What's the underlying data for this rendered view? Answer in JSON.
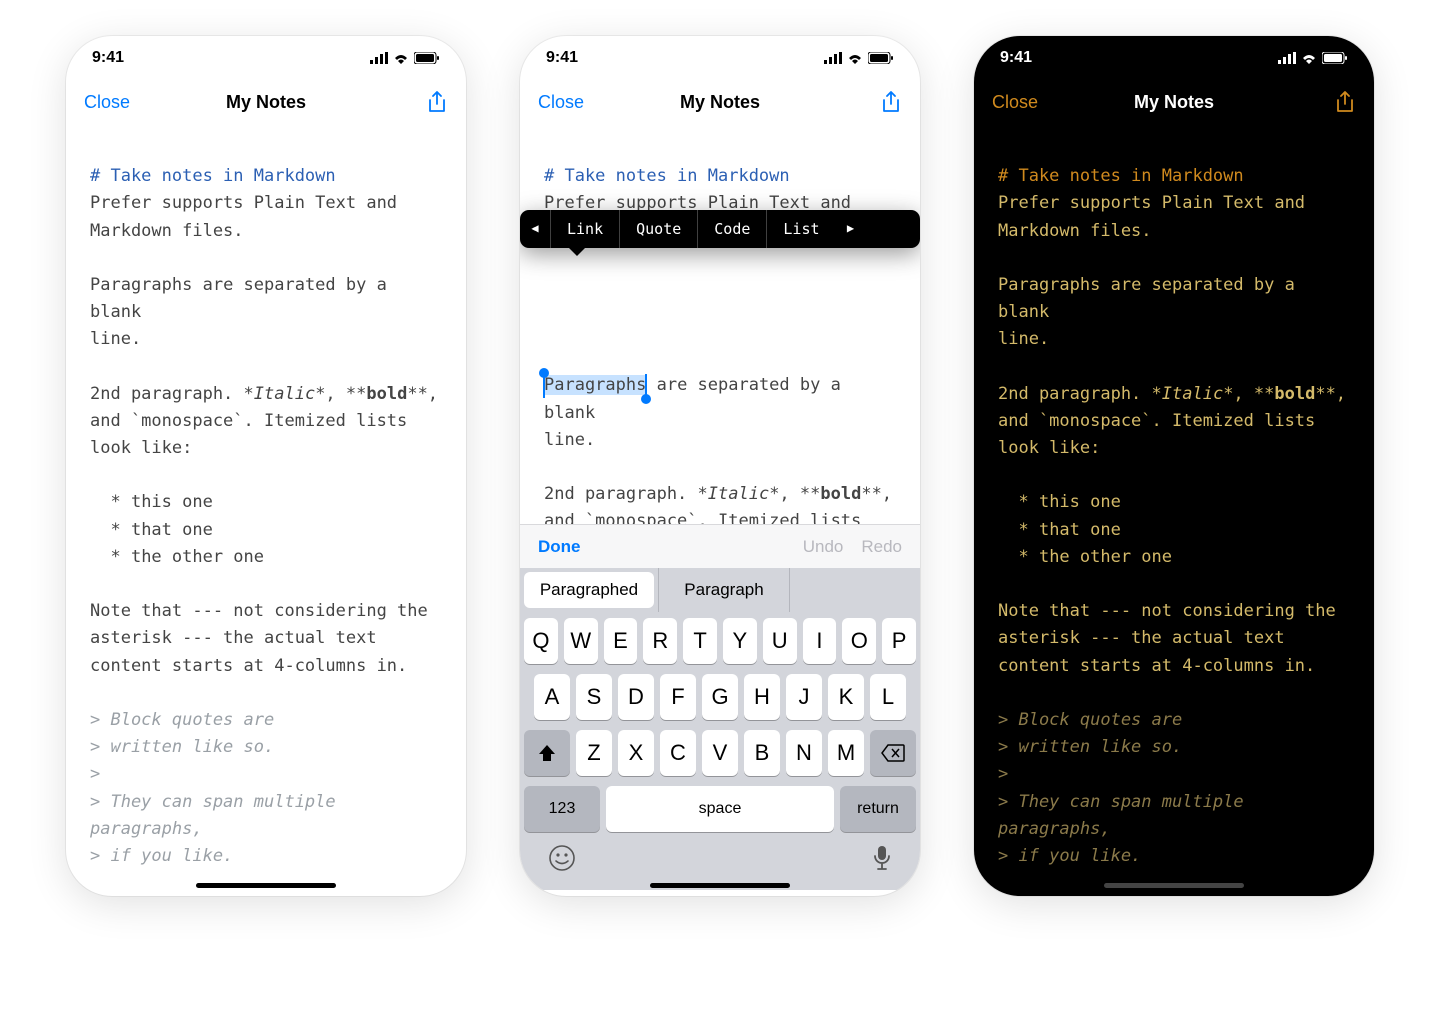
{
  "status": {
    "time": "9:41"
  },
  "nav": {
    "close": "Close",
    "title": "My Notes"
  },
  "note": {
    "heading": "# Take notes in Markdown",
    "l1": "Prefer supports Plain Text and",
    "l2": "Markdown files.",
    "l3a": "Paragraphs",
    "l3b": " are separated by a blank",
    "l4": "line.",
    "l5a": "2nd paragraph. *",
    "l5b": "Italic",
    "l5c": "*, **",
    "l5d": "bold",
    "l5e": "**,",
    "l6": "and `monospace`. Itemized lists",
    "l7": "look like:",
    "li1": "  * this one",
    "li2": "  * that one",
    "li3": "  * the other one",
    "p1": "Note that --- not considering the",
    "p2": "asterisk --- the actual text",
    "p3": "content starts at 4-columns in.",
    "q1": "> Block quotes are",
    "q2": "> written like so.",
    "q3": ">",
    "q4": "> They can span multiple",
    "q5": "paragraphs,",
    "q6": "> if you like."
  },
  "editmenu": {
    "items": [
      "Link",
      "Quote",
      "Code",
      "List"
    ]
  },
  "keyboard": {
    "done": "Done",
    "undo": "Undo",
    "redo": "Redo",
    "suggestions": [
      "Paragraphed",
      "Paragraph",
      ""
    ],
    "row1": [
      "Q",
      "W",
      "E",
      "R",
      "T",
      "Y",
      "U",
      "I",
      "O",
      "P"
    ],
    "row2": [
      "A",
      "S",
      "D",
      "F",
      "G",
      "H",
      "J",
      "K",
      "L"
    ],
    "row3": [
      "Z",
      "X",
      "C",
      "V",
      "B",
      "N",
      "M"
    ],
    "numKey": "123",
    "space": "space",
    "return": "return"
  }
}
